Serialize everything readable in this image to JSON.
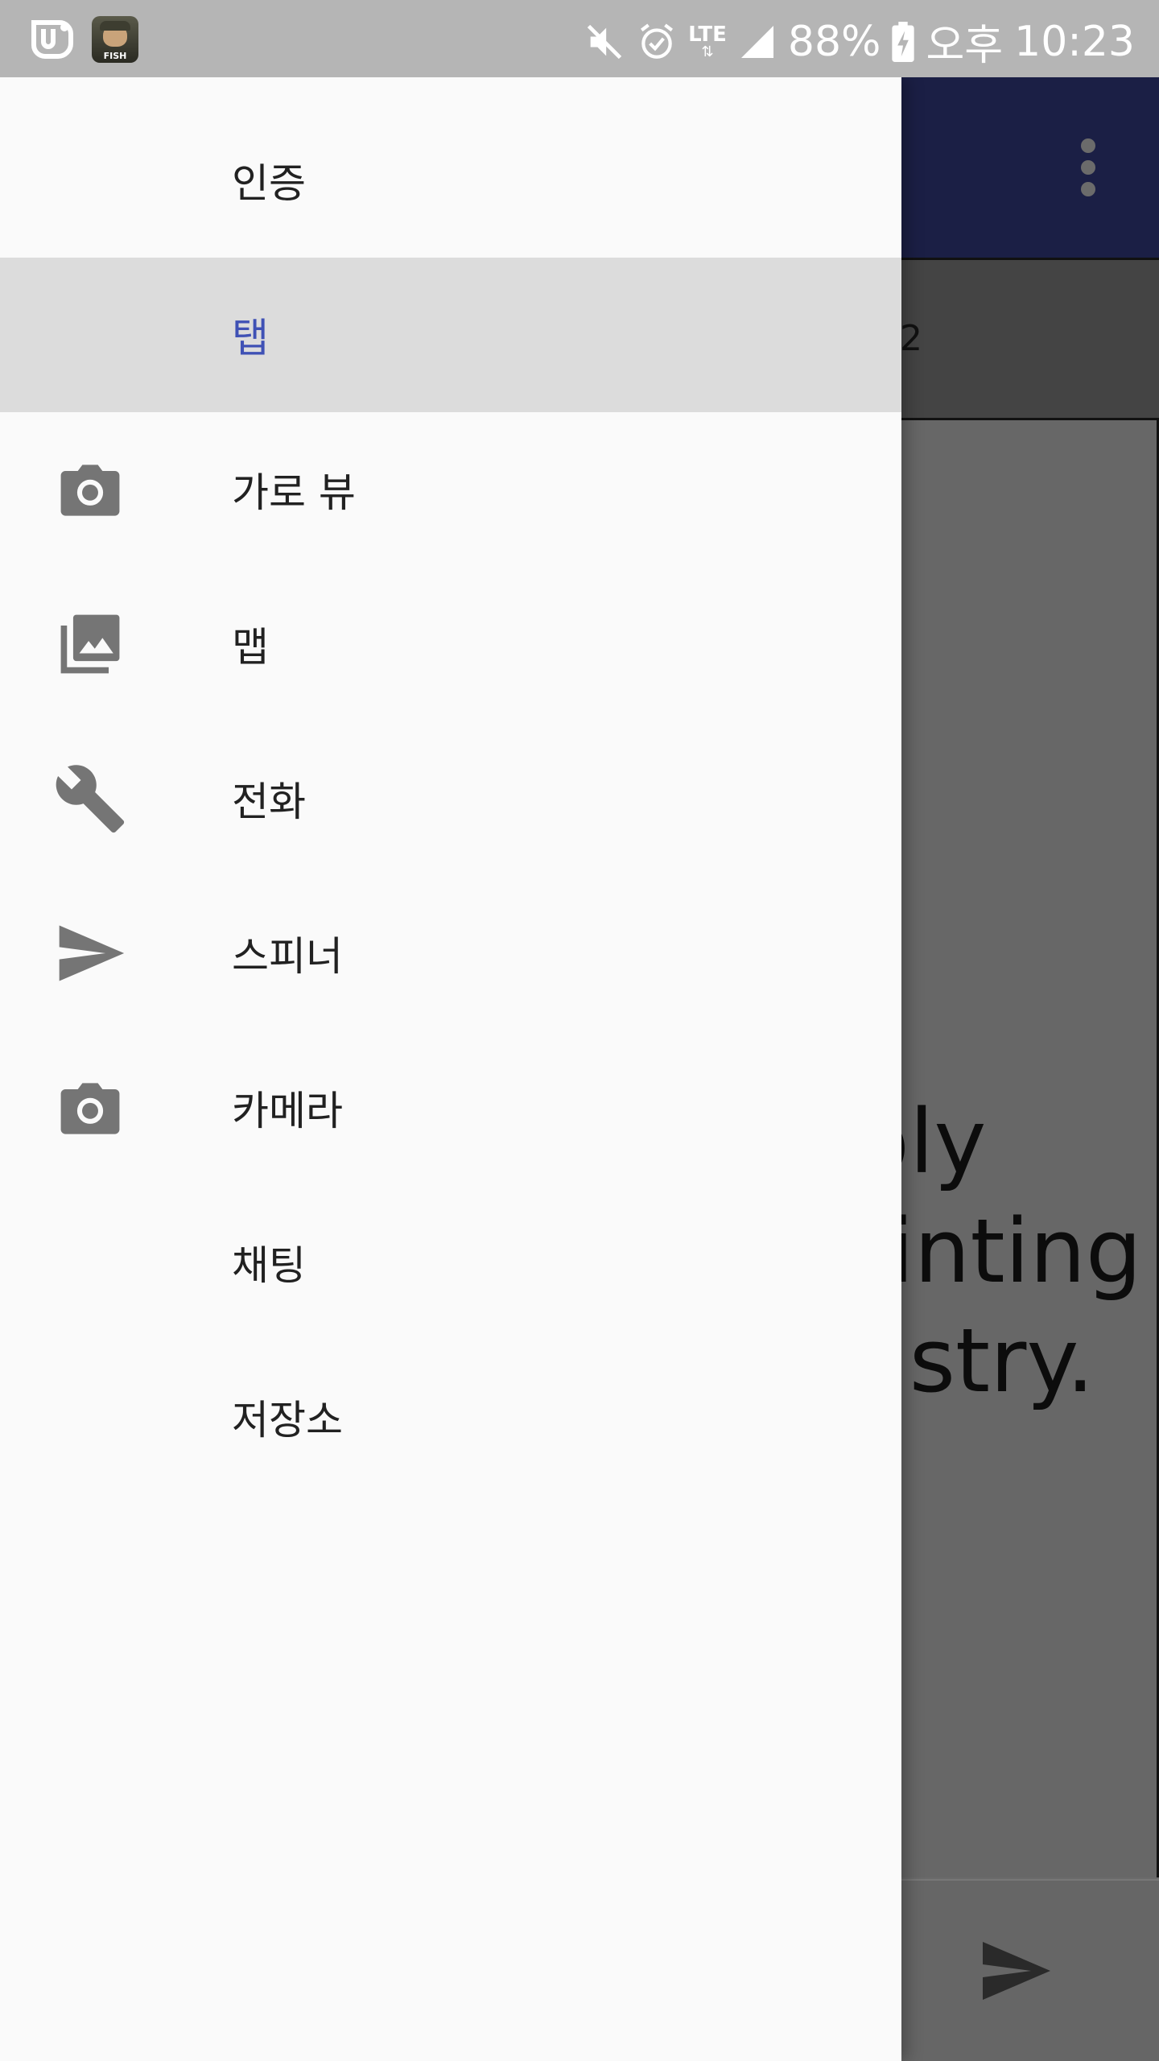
{
  "status_bar": {
    "battery": "88%",
    "ampm": "오후",
    "time": "10:23",
    "network": "LTE",
    "icons": [
      "u-plus-app-icon",
      "fish-game-app-icon",
      "mute-icon",
      "alarm-icon",
      "lte-icon",
      "signal-icon",
      "battery-charging-icon"
    ]
  },
  "background_app": {
    "tab_label": "2",
    "body_lines": [
      "ply",
      "rinting",
      "ustry."
    ],
    "toolbar_icon": "more-vert-icon",
    "send_icon": "send-icon"
  },
  "drawer": {
    "items": [
      {
        "label": "인증",
        "icon": null,
        "active": false
      },
      {
        "label": "탭",
        "icon": null,
        "active": true
      },
      {
        "label": "가로 뷰",
        "icon": "camera-icon",
        "active": false
      },
      {
        "label": "맵",
        "icon": "photo-library-icon",
        "active": false
      },
      {
        "label": "전화",
        "icon": "wrench-icon",
        "active": false
      },
      {
        "label": "스피너",
        "icon": "send-icon",
        "active": false
      },
      {
        "label": "카메라",
        "icon": "camera-icon",
        "active": false
      },
      {
        "label": "채팅",
        "icon": null,
        "active": false
      },
      {
        "label": "저장소",
        "icon": null,
        "active": false
      }
    ]
  },
  "colors": {
    "toolbar": "#1b1f45",
    "active_text": "#3f51b5",
    "active_bg": "#dcdcdc",
    "icon": "#757575"
  }
}
